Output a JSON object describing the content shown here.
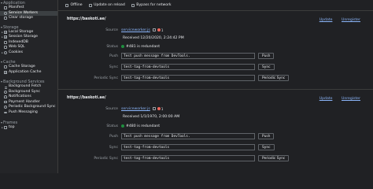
{
  "sidebar": {
    "application_header": "Application",
    "application_items": [
      "Manifest",
      "Service Workers",
      "Clear storage"
    ],
    "storage_header": "Storage",
    "storage_items": [
      "Local Storage",
      "Session Storage",
      "IndexedDB",
      "Web SQL",
      "Cookies"
    ],
    "cache_header": "Cache",
    "cache_items": [
      "Cache Storage",
      "Application Cache"
    ],
    "background_header": "Background Services",
    "background_items": [
      "Background Fetch",
      "Background Sync",
      "Notifications",
      "Payment Handler",
      "Periodic Background Sync",
      "Push Messaging"
    ],
    "frames_header": "Frames",
    "frames_items": [
      "top"
    ]
  },
  "toolbar": {
    "offline": "Offline",
    "update_on_reload": "Update on reload",
    "bypass_for_network": "Bypass for network"
  },
  "workers": [
    {
      "origin": "https://baskoti.ae/",
      "update": "Update",
      "unregister": "Unregister",
      "source_label": "Source",
      "source": "serviceworker.js",
      "error_count": "1",
      "received": "Received 12/20/2020, 2:24:42 PM",
      "status_label": "Status",
      "status": "#481 is redundant",
      "push_label": "Push",
      "push_value": "Test push message from DevTools.",
      "push_button": "Push",
      "sync_label": "Sync",
      "sync_value": "test-tag-from-devtools",
      "sync_button": "Sync",
      "periodic_label": "Periodic Sync",
      "periodic_value": "test-tag-from-devtools",
      "periodic_button": "Periodic Sync"
    },
    {
      "origin": "https://baskoti.ae/",
      "update": "Update",
      "unregister": "Unregister",
      "source_label": "Source",
      "source": "serviceworker.js",
      "error_count": "1",
      "received": "Received 1/1/1970, 2:00:00 AM",
      "status_label": "Status",
      "status": "#480 is redundant",
      "push_label": "Push",
      "push_value": "Test push message from DevTools.",
      "push_button": "Push",
      "sync_label": "Sync",
      "sync_value": "test-tag-from-devtools",
      "sync_button": "Sync",
      "periodic_label": "Periodic Sync",
      "periodic_value": "test-tag-from-devtools",
      "periodic_button": "Periodic Sync"
    }
  ],
  "colors": {
    "accent_link": "#8ab4f8",
    "error_red": "#ee675c",
    "status_green": "#1e8e3e",
    "selected_bg": "#3c4043"
  }
}
